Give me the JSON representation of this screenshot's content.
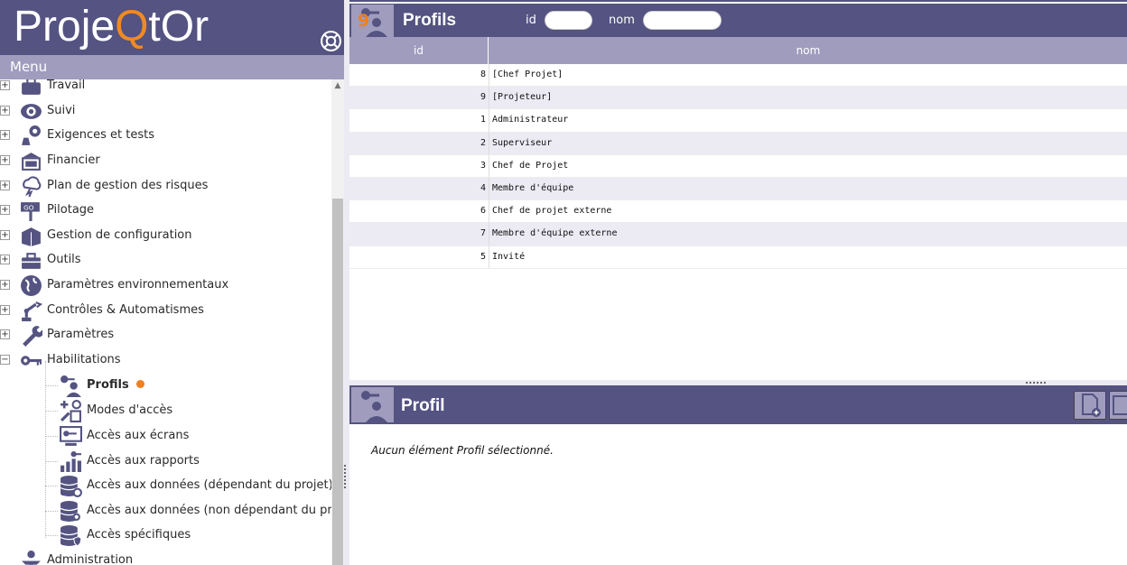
{
  "app": {
    "brand": "ProjeQtOr"
  },
  "menu": {
    "header": "Menu",
    "items": [
      {
        "label": "Travail",
        "icon": "briefcase-icon",
        "expander": "+"
      },
      {
        "label": "Suivi",
        "icon": "eye-icon",
        "expander": "+"
      },
      {
        "label": "Exigences et tests",
        "icon": "flask-icon",
        "expander": "+"
      },
      {
        "label": "Financier",
        "icon": "money-icon",
        "expander": "+"
      },
      {
        "label": "Plan de gestion des risques",
        "icon": "storm-icon",
        "expander": "+"
      },
      {
        "label": "Pilotage",
        "icon": "go-sign-icon",
        "expander": "+"
      },
      {
        "label": "Gestion de configuration",
        "icon": "box-icon",
        "expander": "+"
      },
      {
        "label": "Outils",
        "icon": "toolbox-icon",
        "expander": "+"
      },
      {
        "label": "Paramètres environnementaux",
        "icon": "globe-icon",
        "expander": "+"
      },
      {
        "label": "Contrôles & Automatismes",
        "icon": "robot-arm-icon",
        "expander": "+"
      },
      {
        "label": "Paramètres",
        "icon": "wrench-icon",
        "expander": "+"
      },
      {
        "label": "Habilitations",
        "icon": "key-icon",
        "expander": "−"
      }
    ],
    "sub_items": [
      {
        "label": "Profils",
        "icon": "profile-key-icon",
        "active": true
      },
      {
        "label": "Modes d'accès",
        "icon": "access-mode-icon"
      },
      {
        "label": "Accès aux écrans",
        "icon": "screen-access-icon"
      },
      {
        "label": "Accès aux rapports",
        "icon": "report-access-icon"
      },
      {
        "label": "Accès aux données (dépendant du projet)",
        "icon": "database-gear-icon"
      },
      {
        "label": "Accès aux données (non dépendant du projet)",
        "icon": "database-key-icon"
      },
      {
        "label": "Accès spécifiques",
        "icon": "database-shield-icon"
      }
    ],
    "last_item": {
      "label": "Administration",
      "icon": "admin-icon"
    }
  },
  "list": {
    "title": "Profils",
    "count": "9",
    "filter_id_label": "id",
    "filter_nom_label": "nom",
    "filter_id_value": "",
    "filter_nom_value": "",
    "columns": [
      "id",
      "nom"
    ],
    "rows": [
      {
        "id": "8",
        "nom": "[Chef Projet]"
      },
      {
        "id": "9",
        "nom": "[Projeteur]"
      },
      {
        "id": "1",
        "nom": "Administrateur"
      },
      {
        "id": "2",
        "nom": "Superviseur"
      },
      {
        "id": "3",
        "nom": "Chef de Projet"
      },
      {
        "id": "4",
        "nom": "Membre d'équipe"
      },
      {
        "id": "6",
        "nom": "Chef de projet externe"
      },
      {
        "id": "7",
        "nom": "Membre d'équipe externe"
      },
      {
        "id": "5",
        "nom": "Invité"
      }
    ]
  },
  "detail": {
    "title": "Profil",
    "empty_message": "Aucun élément Profil sélectionné.",
    "buttons": [
      {
        "name": "new-button",
        "icon": "new-document-icon"
      },
      {
        "name": "save-button",
        "icon": "save-icon"
      }
    ]
  },
  "colors": {
    "header_bg": "#545381",
    "sub_header_bg": "#a09cbe",
    "alt_row_bg": "#eceaf3",
    "accent_orange": "#f07f1e"
  }
}
